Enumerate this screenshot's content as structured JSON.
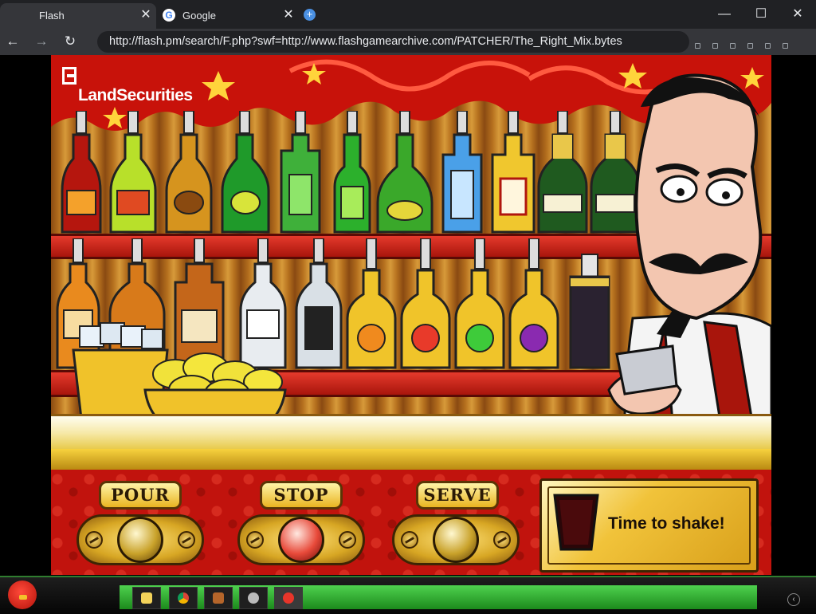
{
  "browser": {
    "tabs": [
      {
        "label": "Flash",
        "active": true
      },
      {
        "label": "Google",
        "active": false
      }
    ],
    "new_tab_icon": "plus-icon",
    "url": "http://flash.pm/search/F.php?swf=http://www.flashgamearchive.com/PATCHER/The_Right_Mix.bytes",
    "window_controls": {
      "minimize": "—",
      "maximize": "☐",
      "close": "✕"
    },
    "nav": {
      "back": "←",
      "forward": "→",
      "reload": "↻"
    },
    "tab_close": "✕",
    "google_favicon_glyph": "G",
    "new_tab_glyph": "+"
  },
  "game": {
    "sponsor_logo": "LandSecurities",
    "buttons": {
      "pour": "POUR",
      "stop": "STOP",
      "serve": "SERVE"
    },
    "status_message": "Time to shake!",
    "colors": {
      "panel_red": "#c1130d",
      "gold": "#e9b421",
      "stop_knob": "#e84a3a"
    }
  },
  "taskbar": {
    "start_icon": "angry-bird-icon",
    "items": [
      "folder-icon",
      "chrome-icon",
      "app-icon",
      "media-icon",
      "angry-bird-icon"
    ],
    "active_item": "angry-bird-icon",
    "tray_glyph": "‹"
  }
}
